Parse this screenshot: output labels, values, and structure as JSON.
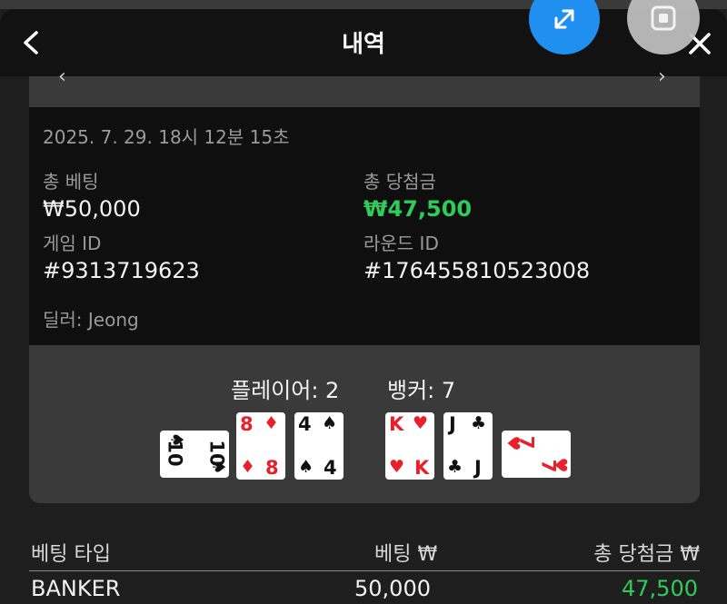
{
  "header": {
    "title": "내역"
  },
  "info": {
    "timestamp": "2025. 7. 29. 18시 12분 15초",
    "total_bet_label": "총 베팅",
    "total_bet_value": "₩50,000",
    "total_win_label": "총 당첨금",
    "total_win_value": "₩47,500",
    "game_id_label": "게임 ID",
    "game_id_value": "#9313719623",
    "round_id_label": "라운드 ID",
    "round_id_value": "#176455810523008",
    "dealer": "딜러: Jeong"
  },
  "result": {
    "player_label": "플레이어: 2",
    "banker_label": "뱅커: 7",
    "player_cards": [
      {
        "rank": "10",
        "suit": "♠",
        "color": "#111111",
        "rotated": true
      },
      {
        "rank": "8",
        "suit": "♦",
        "color": "#e8202a",
        "rotated": false
      },
      {
        "rank": "4",
        "suit": "♠",
        "color": "#111111",
        "rotated": false
      }
    ],
    "banker_cards": [
      {
        "rank": "K",
        "suit": "♥",
        "color": "#e8202a",
        "rotated": false
      },
      {
        "rank": "J",
        "suit": "♣",
        "color": "#111111",
        "rotated": false
      },
      {
        "rank": "7",
        "suit": "♥",
        "color": "#e8202a",
        "rotated": true
      }
    ]
  },
  "table": {
    "headers": [
      "베팅 타입",
      "베팅 ₩",
      "총 당첨금 ₩"
    ],
    "rows": [
      {
        "type": "BANKER",
        "bet": "50,000",
        "win": "47,500"
      }
    ]
  },
  "colors": {
    "accent_blue": "#1f8ff0",
    "win_green": "#2ecc5a",
    "card_red": "#e8202a"
  },
  "icons": [
    "back-icon",
    "close-icon",
    "expand-icon",
    "stop-icon"
  ]
}
